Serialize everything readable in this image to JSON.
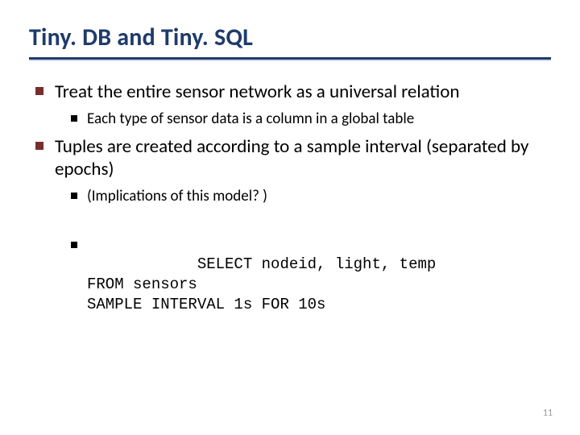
{
  "title": "Tiny. DB and Tiny. SQL",
  "bullets": {
    "b1": "Treat the entire sensor network as a universal relation",
    "b1_1": "Each type of sensor data is a column in a global table",
    "b2": "Tuples are created according to a sample interval (separated by epochs)",
    "b2_1": "(Implications of this model? )",
    "code": "SELECT nodeid, light, temp\nFROM sensors\nSAMPLE INTERVAL 1s FOR 10s"
  },
  "page_number": "11"
}
